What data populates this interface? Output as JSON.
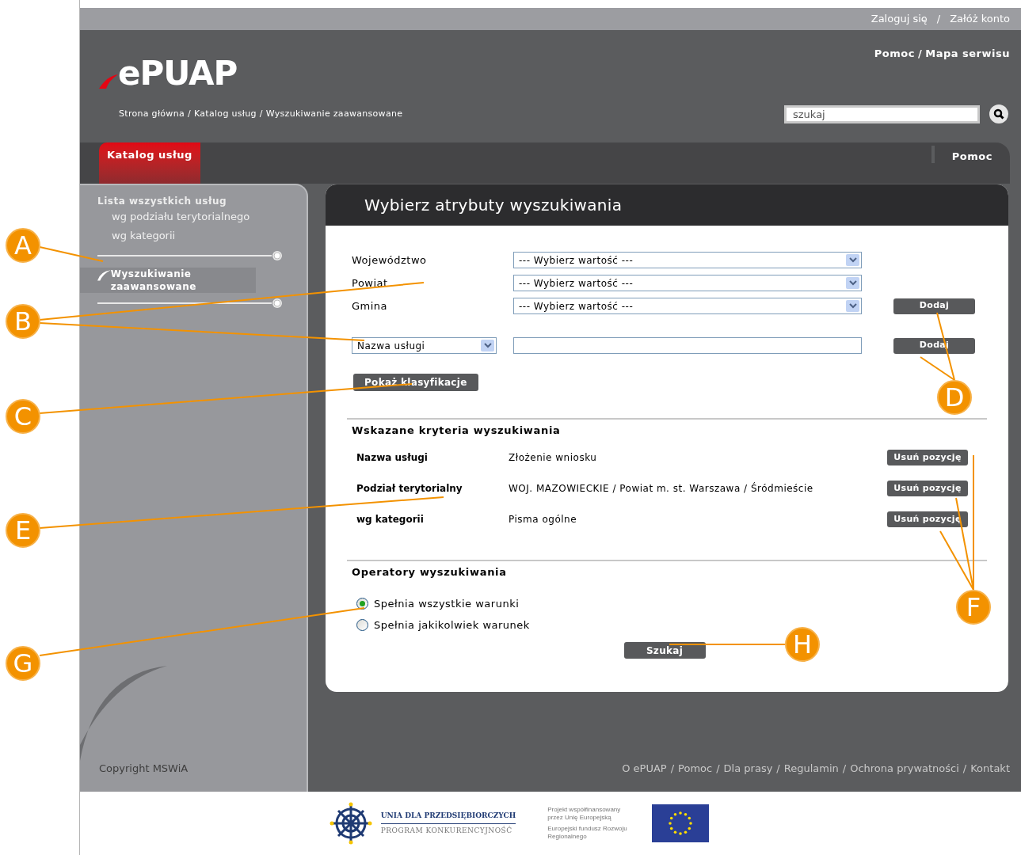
{
  "top_bar": {
    "links": [
      "Zaloguj się",
      "Załóż konto"
    ],
    "separator": "/"
  },
  "header": {
    "logo": "ePUAP",
    "links": [
      "Pomoc",
      "Mapa serwisu"
    ],
    "separator": "/",
    "breadcrumb": [
      "Strona główna",
      "Katalog usług",
      "Wyszukiwanie zaawansowane"
    ],
    "breadcrumb_separator": "/",
    "search": {
      "value": "szukaj"
    }
  },
  "tabs": [
    {
      "label": "Katalog usług",
      "selected": true
    },
    {
      "label": "Pomoc",
      "selected": false
    }
  ],
  "sidebar": {
    "items": [
      {
        "label": "Lista wszystkich usług",
        "selected": false,
        "children": [
          {
            "label": "wg podziału terytorialnego",
            "selected": false
          },
          {
            "label": "wg kategorii",
            "selected": false
          }
        ]
      },
      {
        "label": "Wyszukiwanie zaawansowane",
        "selected": true
      }
    ]
  },
  "panel": {
    "title": "Wybierz atrybuty wyszukiwania",
    "location_fields": [
      {
        "label": "Województwo",
        "value": "--- Wybierz wartość ---"
      },
      {
        "label": "Powiat",
        "value": "--- Wybierz wartość ---"
      },
      {
        "label": "Gmina",
        "value": "--- Wybierz wartość ---"
      }
    ],
    "location_add_button": "Dodaj",
    "service_field": {
      "type": "Nazwa usługi",
      "add_button": "Dodaj"
    },
    "classification_button": "Pokaż klasyfikacje",
    "criteria": {
      "title": "Wskazane kryteria wyszukiwania",
      "rows": [
        {
          "name": "Nazwa usługi",
          "value": "Złożenie wniosku",
          "button": "Usuń pozycję"
        },
        {
          "name": "Podział terytorialny",
          "value": "WOJ. MAZOWIECKIE / Powiat m. st. Warszawa / Śródmieście",
          "button": "Usuń pozycję"
        },
        {
          "name": "wg kategorii",
          "value": "Pisma ogólne",
          "button": "Usuń pozycję"
        }
      ]
    },
    "operators": {
      "title": "Operatory wyszukiwania",
      "options": [
        {
          "label": "Spełnia wszystkie warunki",
          "selected": true
        },
        {
          "label": "Spełnia jakikolwiek warunek",
          "selected": false
        }
      ]
    },
    "search_button": "Szukaj"
  },
  "footer": {
    "copyright": "Copyright MSWiA",
    "links": [
      "O ePUAP",
      "Pomoc",
      "Dla prasy",
      "Regulamin",
      "Ochrona prywatności",
      "Kontakt"
    ],
    "separator": "/"
  },
  "sponsors": {
    "program_title": "UNIA DLA PRZEDSIĘBIORCZYCH",
    "program_subtitle": "PROGRAM KONKURENCYJNOŚĆ",
    "eu_text_1": "Projekt współfinansowany przez Unię Europejską",
    "eu_text_2": "Europejski fundusz Rozwoju Regionalnego"
  },
  "callouts": [
    {
      "label": "A"
    },
    {
      "label": "B"
    },
    {
      "label": "C"
    },
    {
      "label": "D"
    },
    {
      "label": "E"
    },
    {
      "label": "F"
    },
    {
      "label": "G"
    },
    {
      "label": "H"
    }
  ]
}
